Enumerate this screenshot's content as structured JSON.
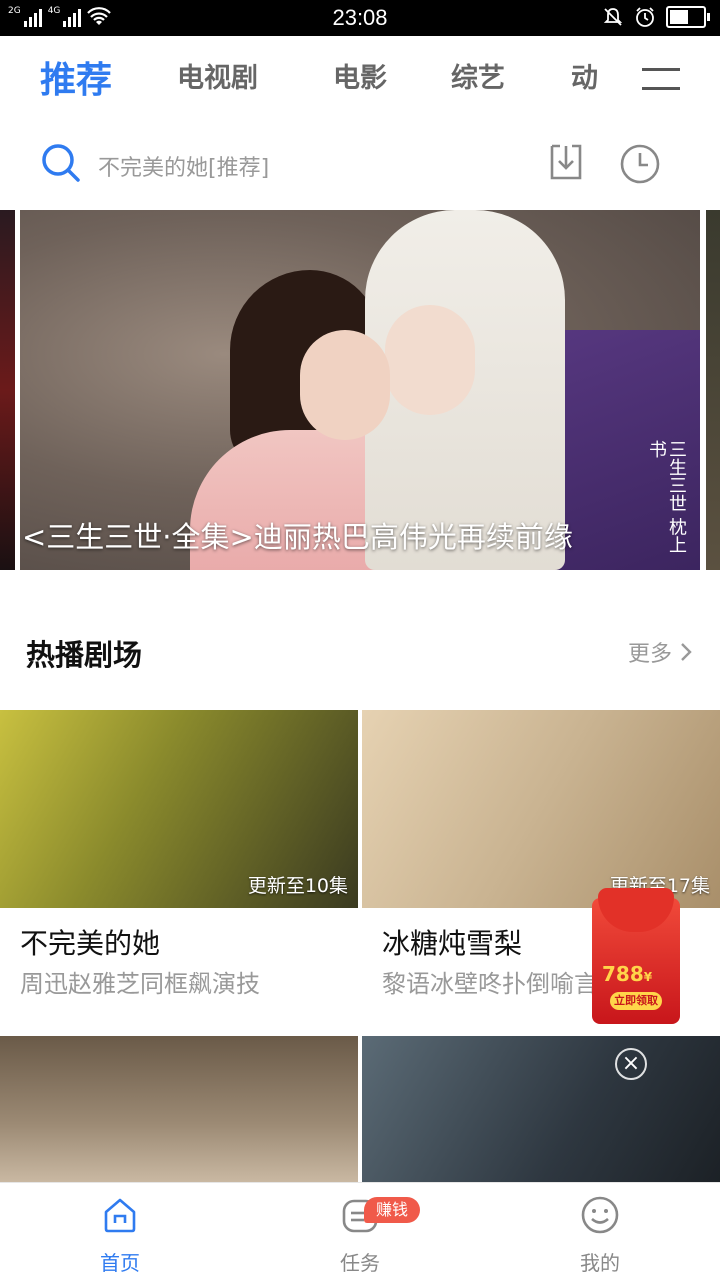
{
  "status_bar": {
    "net_label_1": "2G",
    "net_label_2": "4G",
    "time": "23:08",
    "battery_level": 0.55
  },
  "tabs": [
    {
      "label": "推荐",
      "active": true
    },
    {
      "label": "电视剧",
      "active": false
    },
    {
      "label": "电影",
      "active": false
    },
    {
      "label": "综艺",
      "active": false
    },
    {
      "label": "动",
      "active": false
    }
  ],
  "search": {
    "placeholder": "不完美的她[推荐]"
  },
  "banner": {
    "caption": "<三生三世·全集>迪丽热巴高伟光再续前缘",
    "vertical_text": "三生三世 枕上书"
  },
  "section": {
    "title": "热播剧场",
    "more_label": "更多"
  },
  "cards": [
    {
      "title": "不完美的她",
      "subtitle": "周迅赵雅芝同框飙演技",
      "badge": "更新至10集"
    },
    {
      "title": "冰糖炖雪梨",
      "subtitle": "黎语冰壁咚扑倒喻言",
      "badge": "更新至17集"
    },
    {
      "title": "",
      "subtitle": "",
      "badge": ""
    },
    {
      "title": "",
      "subtitle": "",
      "badge": ""
    }
  ],
  "ad": {
    "amount": "788",
    "currency": "¥",
    "button_label": "立即领取"
  },
  "bottom_nav": {
    "items": [
      {
        "label": "首页",
        "icon": "home-icon",
        "active": true
      },
      {
        "label": "任务",
        "icon": "task-icon",
        "active": false
      },
      {
        "label": "我的",
        "icon": "smiley-icon",
        "active": false
      }
    ],
    "earn_badge": "赚钱"
  },
  "colors": {
    "accent": "#2f7bf0",
    "badge_red": "#f05a4a",
    "muted_text": "#999999"
  }
}
